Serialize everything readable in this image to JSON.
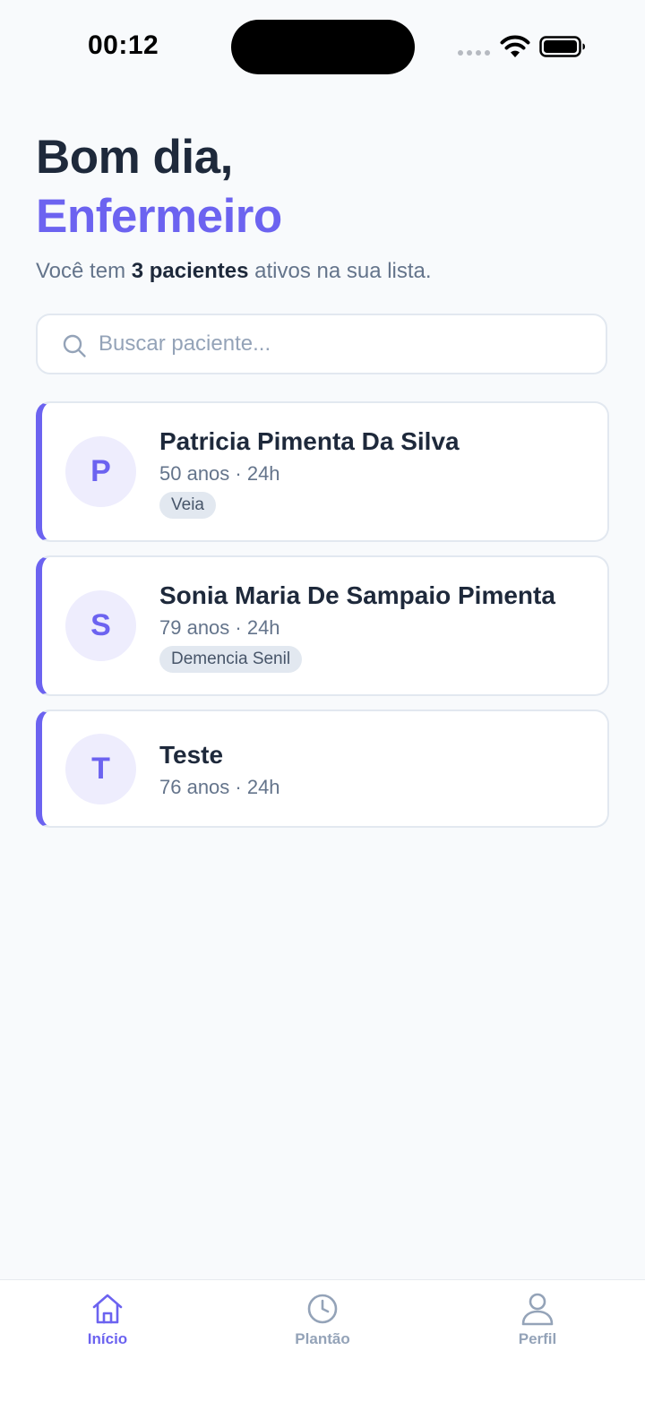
{
  "status_bar": {
    "time": "00:12"
  },
  "header": {
    "greeting": "Bom dia,",
    "user_name": "Enfermeiro",
    "summary_prefix": "Você tem ",
    "summary_count": "3 pacientes",
    "summary_suffix": " ativos na sua lista."
  },
  "search": {
    "placeholder": "Buscar paciente..."
  },
  "patients": [
    {
      "initial": "P",
      "name": "Patricia Pimenta Da Silva",
      "meta": "50 anos · 24h",
      "tag": "Veia"
    },
    {
      "initial": "S",
      "name": "Sonia Maria De Sampaio Pimenta",
      "meta": "79 anos · 24h",
      "tag": "Demencia Senil"
    },
    {
      "initial": "T",
      "name": "Teste",
      "meta": "76 anos · 24h"
    }
  ],
  "tab_bar": {
    "tabs": [
      {
        "label": "Início",
        "icon": "home-icon",
        "active": true
      },
      {
        "label": "Plantão",
        "icon": "clock-icon",
        "active": false
      },
      {
        "label": "Perfil",
        "icon": "user-icon",
        "active": false
      }
    ]
  },
  "colors": {
    "accent": "#6C63F0",
    "text_primary": "#1E293B",
    "text_secondary": "#64748B",
    "background": "#F8FAFC",
    "tag_background": "#E2E8F0"
  }
}
